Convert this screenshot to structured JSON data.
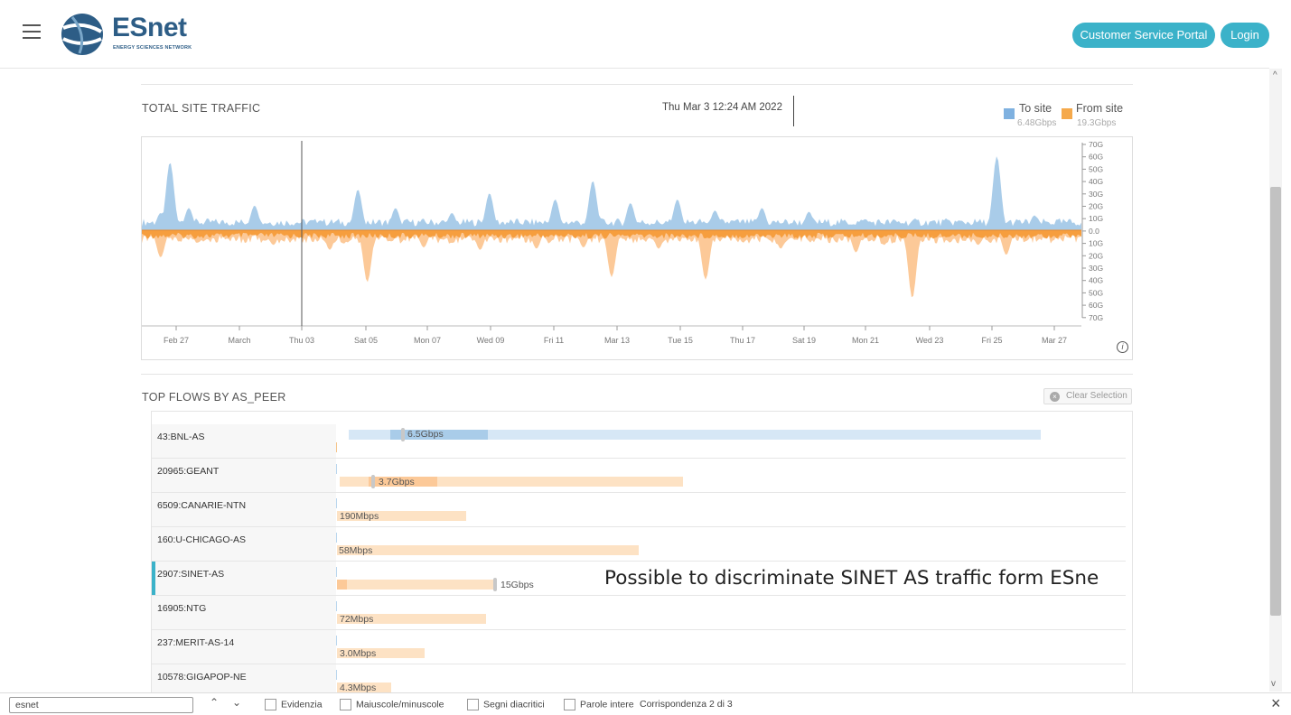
{
  "header": {
    "logo_text": "ESnet",
    "logo_subtitle": "ENERGY SCIENCES NETWORK",
    "portal_button": "Customer Service Portal",
    "login_button": "Login",
    "accent_color": "#3bb2c9",
    "brand_color": "#2d5d86"
  },
  "traffic": {
    "title": "TOTAL SITE TRAFFIC",
    "timestamp": "Thu Mar 3 12:24 AM 2022",
    "legend": [
      {
        "label": "To site",
        "value": "6.48Gbps",
        "color": "#8fbce6"
      },
      {
        "label": "From site",
        "value": "19.3Gbps",
        "color": "#f5a94b"
      }
    ]
  },
  "chart_data": {
    "type": "area",
    "title": "TOTAL SITE TRAFFIC",
    "x_ticks": [
      "Feb 27",
      "March",
      "Thu 03",
      "Sat 05",
      "Mon 07",
      "Wed 09",
      "Fri 11",
      "Mar 13",
      "Tue 15",
      "Thu 17",
      "Sat 19",
      "Mon 21",
      "Wed 23",
      "Fri 25",
      "Mar 27"
    ],
    "y_ticks": [
      "70G",
      "60G",
      "50G",
      "40G",
      "30G",
      "20G",
      "10G",
      "0.0",
      "10G",
      "20G",
      "30G",
      "40G",
      "50G",
      "60G",
      "70G"
    ],
    "ylim": [
      -70,
      70
    ],
    "y_unit": "Gbps",
    "series": [
      {
        "name": "To site",
        "direction": "up",
        "color": "#a9cce9",
        "peaks": [
          [
            0.02,
            14
          ],
          [
            0.03,
            55
          ],
          [
            0.05,
            18
          ],
          [
            0.12,
            20
          ],
          [
            0.19,
            8
          ],
          [
            0.23,
            33
          ],
          [
            0.27,
            18
          ],
          [
            0.33,
            14
          ],
          [
            0.37,
            30
          ],
          [
            0.44,
            25
          ],
          [
            0.48,
            40
          ],
          [
            0.52,
            22
          ],
          [
            0.57,
            25
          ],
          [
            0.61,
            16
          ],
          [
            0.66,
            18
          ],
          [
            0.71,
            15
          ],
          [
            0.77,
            9
          ],
          [
            0.84,
            5
          ],
          [
            0.87,
            7
          ],
          [
            0.91,
            60
          ],
          [
            0.95,
            12
          ],
          [
            0.99,
            5
          ]
        ]
      },
      {
        "name": "From site",
        "direction": "down",
        "color": "#fcc998",
        "peaks": [
          [
            0.02,
            22
          ],
          [
            0.06,
            10
          ],
          [
            0.14,
            12
          ],
          [
            0.2,
            16
          ],
          [
            0.24,
            42
          ],
          [
            0.3,
            14
          ],
          [
            0.36,
            16
          ],
          [
            0.42,
            15
          ],
          [
            0.47,
            14
          ],
          [
            0.5,
            38
          ],
          [
            0.55,
            15
          ],
          [
            0.6,
            40
          ],
          [
            0.64,
            10
          ],
          [
            0.68,
            15
          ],
          [
            0.76,
            18
          ],
          [
            0.79,
            12
          ],
          [
            0.82,
            55
          ],
          [
            0.86,
            10
          ],
          [
            0.89,
            12
          ],
          [
            0.92,
            20
          ],
          [
            0.98,
            5
          ]
        ]
      }
    ],
    "cursor_label": "Thu 03"
  },
  "flows": {
    "title": "TOP FLOWS BY AS_PEER",
    "clear_button": "Clear Selection",
    "rows": [
      {
        "label": "43:BNL-AS",
        "value": "6.5Gbps",
        "type": "to",
        "selected": false
      },
      {
        "label": "20965:GEANT",
        "value": "3.7Gbps",
        "type": "from",
        "selected": false
      },
      {
        "label": "6509:CANARIE-NTN",
        "value": "190Mbps",
        "type": "from",
        "selected": false
      },
      {
        "label": "160:U-CHICAGO-AS",
        "value": "58Mbps",
        "type": "from",
        "selected": false
      },
      {
        "label": "2907:SINET-AS",
        "value": "15Gbps",
        "type": "from",
        "selected": true
      },
      {
        "label": "16905:NTG",
        "value": "72Mbps",
        "type": "from",
        "selected": false
      },
      {
        "label": "237:MERIT-AS-14",
        "value": "3.0Mbps",
        "type": "from",
        "selected": false
      },
      {
        "label": "10578:GIGAPOP-NE",
        "value": "4.3Mbps",
        "type": "from",
        "selected": false
      }
    ]
  },
  "annotation": "Possible to discriminate SINET AS traffic form ESne",
  "findbar": {
    "query": "esnet",
    "options": [
      "Evidenzia",
      "Maiuscole/minuscole",
      "Segni diacritici",
      "Parole intere"
    ],
    "count": "Corrispondenza 2 di 3"
  }
}
